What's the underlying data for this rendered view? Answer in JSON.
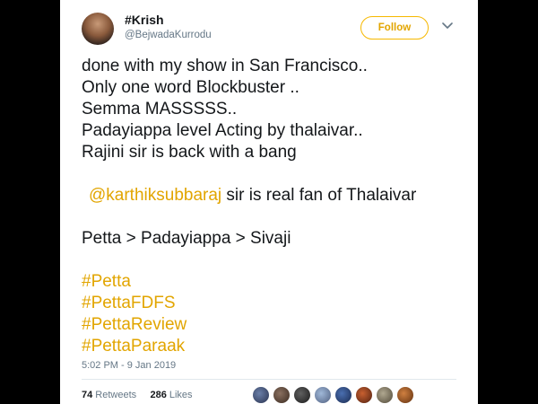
{
  "tweet": {
    "display_name": "#Krish",
    "handle": "@BejwadaKurrodu",
    "follow_label": "Follow",
    "lines": [
      "done with my show in San Francisco..",
      "Only one word Blockbuster ..",
      "Semma MASSSSS..",
      "Padayiappa level Acting by thalaivar..",
      "Rajini sir is back with a bang"
    ],
    "mention": "@karthiksubbaraj",
    "mention_suffix": " sir is real fan of Thalaivar",
    "comparison": "Petta > Padayiappa > Sivaji",
    "hashtags": [
      "#Petta",
      "#PettaFDFS",
      "#PettaReview",
      "#PettaParaak"
    ],
    "timestamp": "5:02 PM - 9 Jan 2019",
    "retweets_count": "74",
    "retweets_label": " Retweets",
    "likes_count": "286",
    "likes_label": " Likes"
  },
  "colors": {
    "accent": "#e2a500",
    "text": "#14171a",
    "muted": "#657786"
  },
  "icons": {
    "more": "chevron-down-icon"
  }
}
